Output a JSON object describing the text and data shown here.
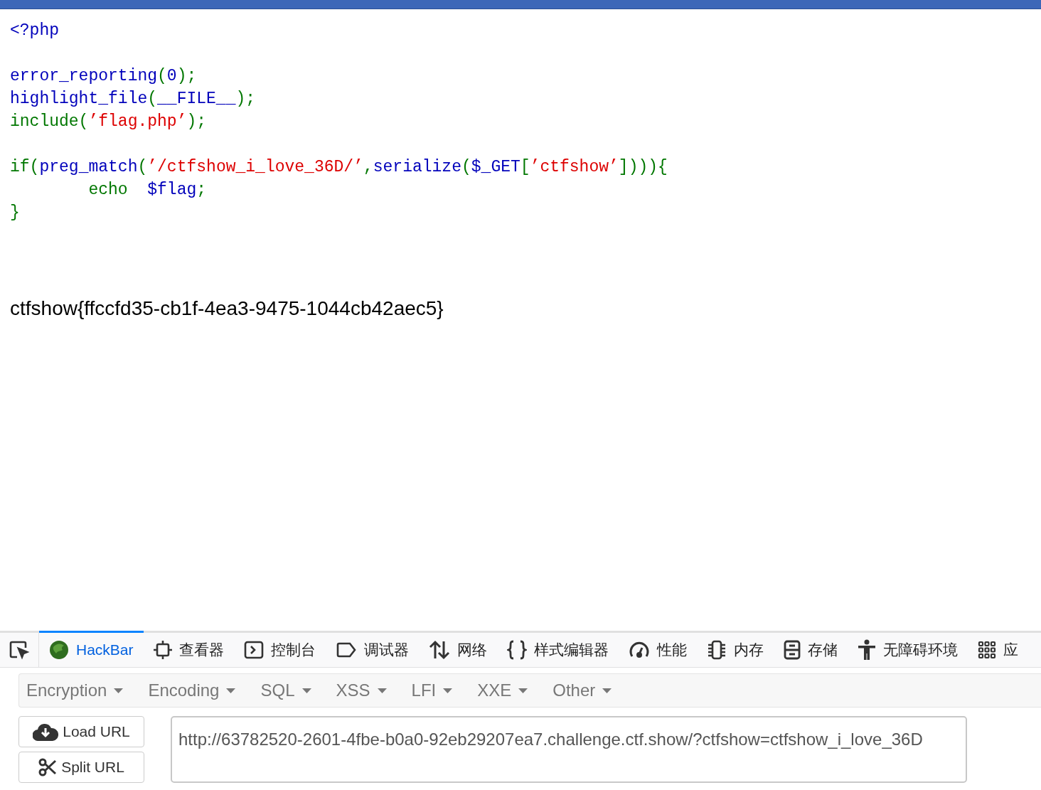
{
  "code_blocks": [
    [
      [
        {
          "text": "<?php",
          "kind": "default"
        }
      ]
    ],
    [
      [
        {
          "text": "error_reporting",
          "kind": "default"
        },
        {
          "text": "(",
          "kind": "keyword"
        },
        {
          "text": "0",
          "kind": "default"
        },
        {
          "text": ");",
          "kind": "keyword"
        }
      ],
      [
        {
          "text": "highlight_file",
          "kind": "default"
        },
        {
          "text": "(",
          "kind": "keyword"
        },
        {
          "text": "__FILE__",
          "kind": "default"
        },
        {
          "text": ");",
          "kind": "keyword"
        }
      ],
      [
        {
          "text": "include(",
          "kind": "keyword"
        },
        {
          "text": "’flag.php’",
          "kind": "string"
        },
        {
          "text": ");",
          "kind": "keyword"
        }
      ]
    ],
    [
      [
        {
          "text": "if(",
          "kind": "keyword"
        },
        {
          "text": "preg_match",
          "kind": "default"
        },
        {
          "text": "(",
          "kind": "keyword"
        },
        {
          "text": "’/ctfshow_i_love_36D/’",
          "kind": "string"
        },
        {
          "text": ",",
          "kind": "keyword"
        },
        {
          "text": "serialize",
          "kind": "default"
        },
        {
          "text": "(",
          "kind": "keyword"
        },
        {
          "text": "$_GET",
          "kind": "default"
        },
        {
          "text": "[",
          "kind": "keyword"
        },
        {
          "text": "’ctfshow’",
          "kind": "string"
        },
        {
          "text": "]))){",
          "kind": "keyword"
        }
      ],
      [
        {
          "text": "        echo  ",
          "kind": "keyword"
        },
        {
          "text": "$flag",
          "kind": "default"
        },
        {
          "text": ";",
          "kind": "keyword"
        }
      ],
      [
        {
          "text": "}",
          "kind": "keyword"
        }
      ]
    ]
  ],
  "output": "ctfshow{ffccfd35-cb1f-4ea3-9475-1044cb42aec5}",
  "devtools": {
    "tabs": [
      {
        "kind": "picker",
        "selected": false
      },
      {
        "kind": "hackbar",
        "label": "HackBar",
        "selected": true
      },
      {
        "kind": "inspector",
        "label": "查看器",
        "selected": false
      },
      {
        "kind": "console",
        "label": "控制台",
        "selected": false
      },
      {
        "kind": "debugger",
        "label": "调试器",
        "selected": false
      },
      {
        "kind": "network",
        "label": "网络",
        "selected": false
      },
      {
        "kind": "style",
        "label": "样式编辑器",
        "selected": false
      },
      {
        "kind": "performance",
        "label": "性能",
        "selected": false
      },
      {
        "kind": "memory",
        "label": "内存",
        "selected": false
      },
      {
        "kind": "storage",
        "label": "存储",
        "selected": false
      },
      {
        "kind": "accessibility",
        "label": "无障碍环境",
        "selected": false
      },
      {
        "kind": "apps",
        "label": "应",
        "selected": false
      }
    ]
  },
  "hackbar": {
    "menus": [
      "Encryption",
      "Encoding",
      "SQL",
      "XSS",
      "LFI",
      "XXE",
      "Other"
    ],
    "buttons": [
      {
        "kind": "load",
        "label": "Load URL"
      },
      {
        "kind": "split",
        "label": "Split URL"
      }
    ],
    "url": "http://63782520-2601-4fbe-b0a0-92eb29207ea7.challenge.ctf.show/?ctfshow=ctfshow_i_love_36D"
  }
}
